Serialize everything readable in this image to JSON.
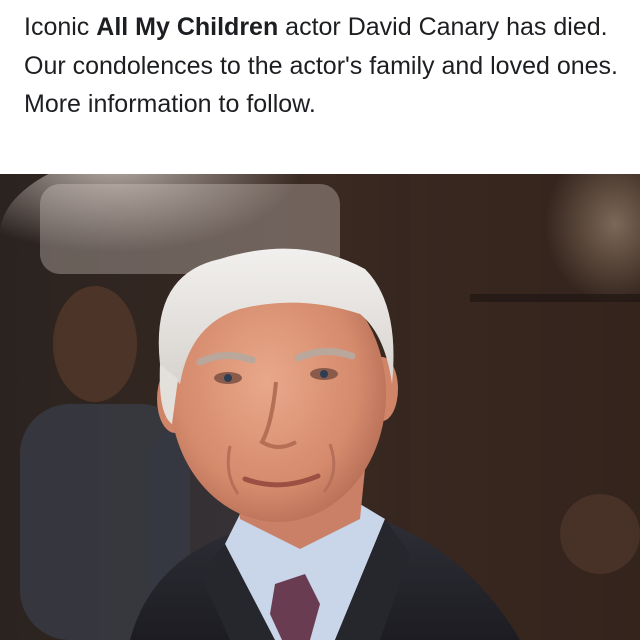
{
  "post": {
    "caption": {
      "part1": "Iconic ",
      "bold": "All My Children",
      "part2": " actor David Canary has died. Our condolences to the actor's family and loved ones. More information to follow."
    },
    "photo": {
      "icon": "portrait-photo"
    }
  }
}
